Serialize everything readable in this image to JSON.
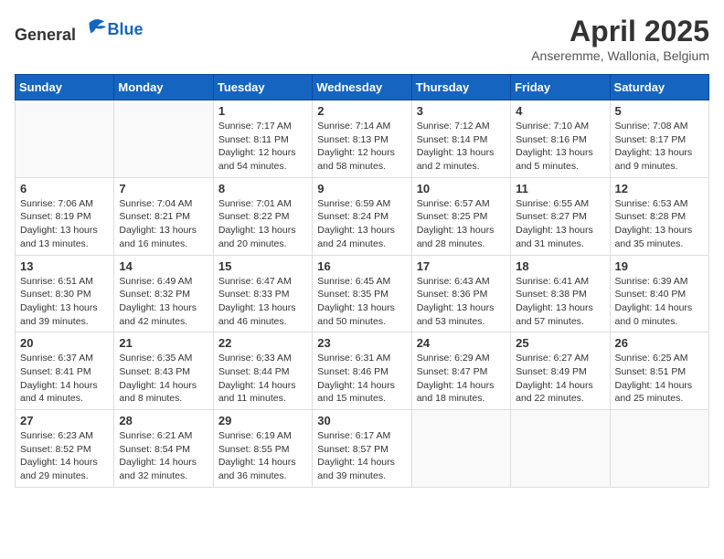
{
  "header": {
    "logo_general": "General",
    "logo_blue": "Blue",
    "month_title": "April 2025",
    "location": "Anseremme, Wallonia, Belgium"
  },
  "weekdays": [
    "Sunday",
    "Monday",
    "Tuesday",
    "Wednesday",
    "Thursday",
    "Friday",
    "Saturday"
  ],
  "weeks": [
    [
      {
        "day": "",
        "info": ""
      },
      {
        "day": "",
        "info": ""
      },
      {
        "day": "1",
        "info": "Sunrise: 7:17 AM\nSunset: 8:11 PM\nDaylight: 12 hours\nand 54 minutes."
      },
      {
        "day": "2",
        "info": "Sunrise: 7:14 AM\nSunset: 8:13 PM\nDaylight: 12 hours\nand 58 minutes."
      },
      {
        "day": "3",
        "info": "Sunrise: 7:12 AM\nSunset: 8:14 PM\nDaylight: 13 hours\nand 2 minutes."
      },
      {
        "day": "4",
        "info": "Sunrise: 7:10 AM\nSunset: 8:16 PM\nDaylight: 13 hours\nand 5 minutes."
      },
      {
        "day": "5",
        "info": "Sunrise: 7:08 AM\nSunset: 8:17 PM\nDaylight: 13 hours\nand 9 minutes."
      }
    ],
    [
      {
        "day": "6",
        "info": "Sunrise: 7:06 AM\nSunset: 8:19 PM\nDaylight: 13 hours\nand 13 minutes."
      },
      {
        "day": "7",
        "info": "Sunrise: 7:04 AM\nSunset: 8:21 PM\nDaylight: 13 hours\nand 16 minutes."
      },
      {
        "day": "8",
        "info": "Sunrise: 7:01 AM\nSunset: 8:22 PM\nDaylight: 13 hours\nand 20 minutes."
      },
      {
        "day": "9",
        "info": "Sunrise: 6:59 AM\nSunset: 8:24 PM\nDaylight: 13 hours\nand 24 minutes."
      },
      {
        "day": "10",
        "info": "Sunrise: 6:57 AM\nSunset: 8:25 PM\nDaylight: 13 hours\nand 28 minutes."
      },
      {
        "day": "11",
        "info": "Sunrise: 6:55 AM\nSunset: 8:27 PM\nDaylight: 13 hours\nand 31 minutes."
      },
      {
        "day": "12",
        "info": "Sunrise: 6:53 AM\nSunset: 8:28 PM\nDaylight: 13 hours\nand 35 minutes."
      }
    ],
    [
      {
        "day": "13",
        "info": "Sunrise: 6:51 AM\nSunset: 8:30 PM\nDaylight: 13 hours\nand 39 minutes."
      },
      {
        "day": "14",
        "info": "Sunrise: 6:49 AM\nSunset: 8:32 PM\nDaylight: 13 hours\nand 42 minutes."
      },
      {
        "day": "15",
        "info": "Sunrise: 6:47 AM\nSunset: 8:33 PM\nDaylight: 13 hours\nand 46 minutes."
      },
      {
        "day": "16",
        "info": "Sunrise: 6:45 AM\nSunset: 8:35 PM\nDaylight: 13 hours\nand 50 minutes."
      },
      {
        "day": "17",
        "info": "Sunrise: 6:43 AM\nSunset: 8:36 PM\nDaylight: 13 hours\nand 53 minutes."
      },
      {
        "day": "18",
        "info": "Sunrise: 6:41 AM\nSunset: 8:38 PM\nDaylight: 13 hours\nand 57 minutes."
      },
      {
        "day": "19",
        "info": "Sunrise: 6:39 AM\nSunset: 8:40 PM\nDaylight: 14 hours\nand 0 minutes."
      }
    ],
    [
      {
        "day": "20",
        "info": "Sunrise: 6:37 AM\nSunset: 8:41 PM\nDaylight: 14 hours\nand 4 minutes."
      },
      {
        "day": "21",
        "info": "Sunrise: 6:35 AM\nSunset: 8:43 PM\nDaylight: 14 hours\nand 8 minutes."
      },
      {
        "day": "22",
        "info": "Sunrise: 6:33 AM\nSunset: 8:44 PM\nDaylight: 14 hours\nand 11 minutes."
      },
      {
        "day": "23",
        "info": "Sunrise: 6:31 AM\nSunset: 8:46 PM\nDaylight: 14 hours\nand 15 minutes."
      },
      {
        "day": "24",
        "info": "Sunrise: 6:29 AM\nSunset: 8:47 PM\nDaylight: 14 hours\nand 18 minutes."
      },
      {
        "day": "25",
        "info": "Sunrise: 6:27 AM\nSunset: 8:49 PM\nDaylight: 14 hours\nand 22 minutes."
      },
      {
        "day": "26",
        "info": "Sunrise: 6:25 AM\nSunset: 8:51 PM\nDaylight: 14 hours\nand 25 minutes."
      }
    ],
    [
      {
        "day": "27",
        "info": "Sunrise: 6:23 AM\nSunset: 8:52 PM\nDaylight: 14 hours\nand 29 minutes."
      },
      {
        "day": "28",
        "info": "Sunrise: 6:21 AM\nSunset: 8:54 PM\nDaylight: 14 hours\nand 32 minutes."
      },
      {
        "day": "29",
        "info": "Sunrise: 6:19 AM\nSunset: 8:55 PM\nDaylight: 14 hours\nand 36 minutes."
      },
      {
        "day": "30",
        "info": "Sunrise: 6:17 AM\nSunset: 8:57 PM\nDaylight: 14 hours\nand 39 minutes."
      },
      {
        "day": "",
        "info": ""
      },
      {
        "day": "",
        "info": ""
      },
      {
        "day": "",
        "info": ""
      }
    ]
  ]
}
